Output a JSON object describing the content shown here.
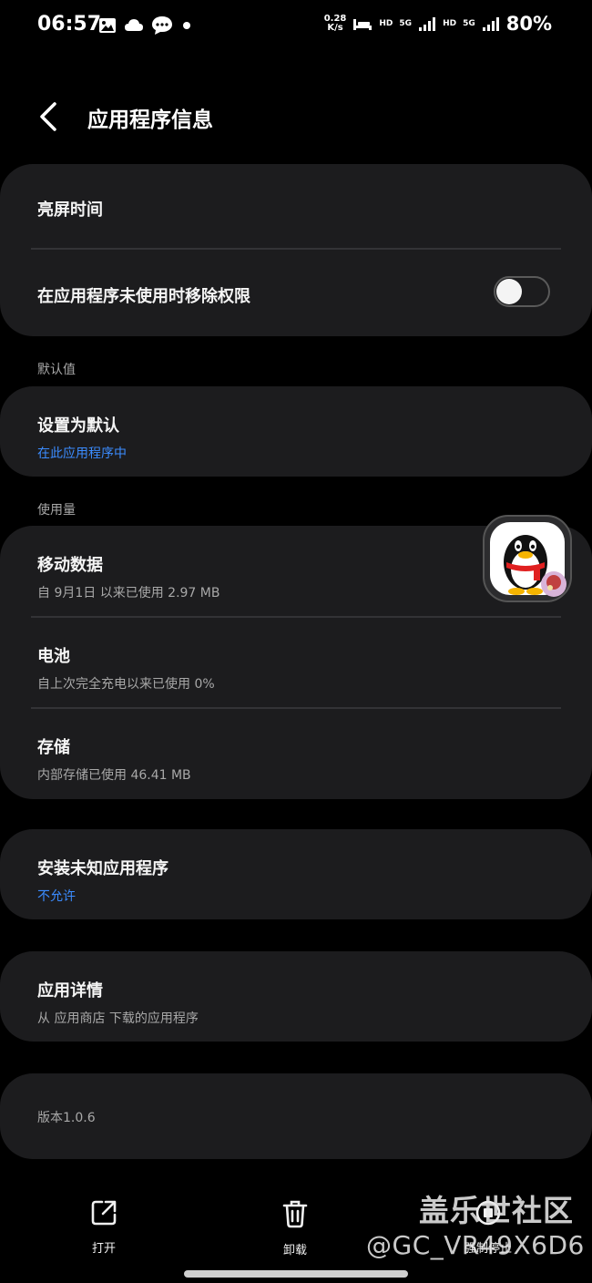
{
  "status_bar": {
    "time": "06:57",
    "speed_value": "0.28",
    "speed_unit": "K/s",
    "hd1": "HD",
    "net1": "5G",
    "hd2": "HD",
    "net2": "5G",
    "battery": "80%"
  },
  "header": {
    "title": "应用程序信息"
  },
  "screen_time": {
    "title": "亮屏时间"
  },
  "remove_permissions": {
    "title": "在应用程序未使用时移除权限",
    "enabled": false
  },
  "defaults_section": "默认值",
  "set_default": {
    "title": "设置为默认",
    "sub": "在此应用程序中"
  },
  "usage_section": "使用量",
  "mobile_data": {
    "title": "移动数据",
    "sub": "自 9月1日 以来已使用 2.97 MB"
  },
  "battery_item": {
    "title": "电池",
    "sub": "自上次完全充电以来已使用 0%"
  },
  "storage": {
    "title": "存储",
    "sub": "内部存储已使用 46.41 MB"
  },
  "install_unknown": {
    "title": "安装未知应用程序",
    "sub": "不允许"
  },
  "app_details": {
    "title": "应用详情",
    "sub": "从 应用商店 下载的应用程序"
  },
  "version": "版本1.0.6",
  "bottom_bar": {
    "open": "打开",
    "uninstall": "卸载",
    "force_stop": "强制停止"
  },
  "watermark": {
    "line1": "盖乐世社区",
    "line2": "@GC_VR49X6D6"
  },
  "colors": {
    "accent_blue": "#3b8cff",
    "card_bg": "#1c1c1e",
    "background": "#000000"
  }
}
